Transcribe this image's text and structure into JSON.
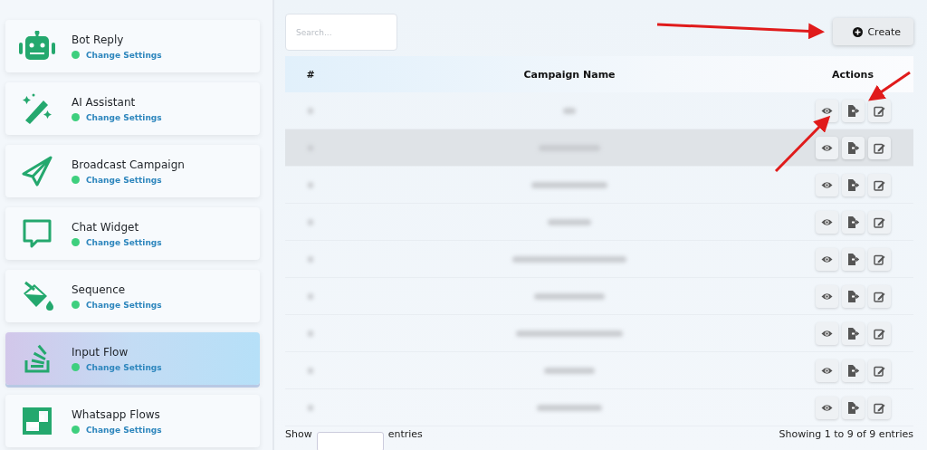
{
  "sidebar": {
    "items": [
      {
        "title": "Bot Reply",
        "link": "Change Settings",
        "color": "#3ecf7e",
        "selected": false
      },
      {
        "title": "AI Assistant",
        "link": "Change Settings",
        "color": "#3ecf7e",
        "selected": false
      },
      {
        "title": "Broadcast Campaign",
        "link": "Change Settings",
        "color": "#3ecf7e",
        "selected": false
      },
      {
        "title": "Chat Widget",
        "link": "Change Settings",
        "color": "#3ecf7e",
        "selected": false
      },
      {
        "title": "Sequence",
        "link": "Change Settings",
        "color": "#3ecf7e",
        "selected": false
      },
      {
        "title": "Input Flow",
        "link": "Change Settings",
        "color": "#3ecf7e",
        "selected": true
      },
      {
        "title": "Whatsapp Flows",
        "link": "Change Settings",
        "color": "#3ecf7e",
        "selected": false
      }
    ]
  },
  "search": {
    "placeholder": "Search..."
  },
  "create_button": {
    "label": "Create"
  },
  "table": {
    "columns": [
      "#",
      "Campaign Name",
      "Actions"
    ],
    "rows": [
      {
        "highlighted": false
      },
      {
        "highlighted": true
      },
      {
        "highlighted": false
      },
      {
        "highlighted": false
      },
      {
        "highlighted": false
      },
      {
        "highlighted": false
      },
      {
        "highlighted": false
      },
      {
        "highlighted": false
      },
      {
        "highlighted": false
      }
    ]
  },
  "footer": {
    "show_label": "Show",
    "entries_label": "entries",
    "info": "Showing 1 to 9 of 9 entries"
  }
}
